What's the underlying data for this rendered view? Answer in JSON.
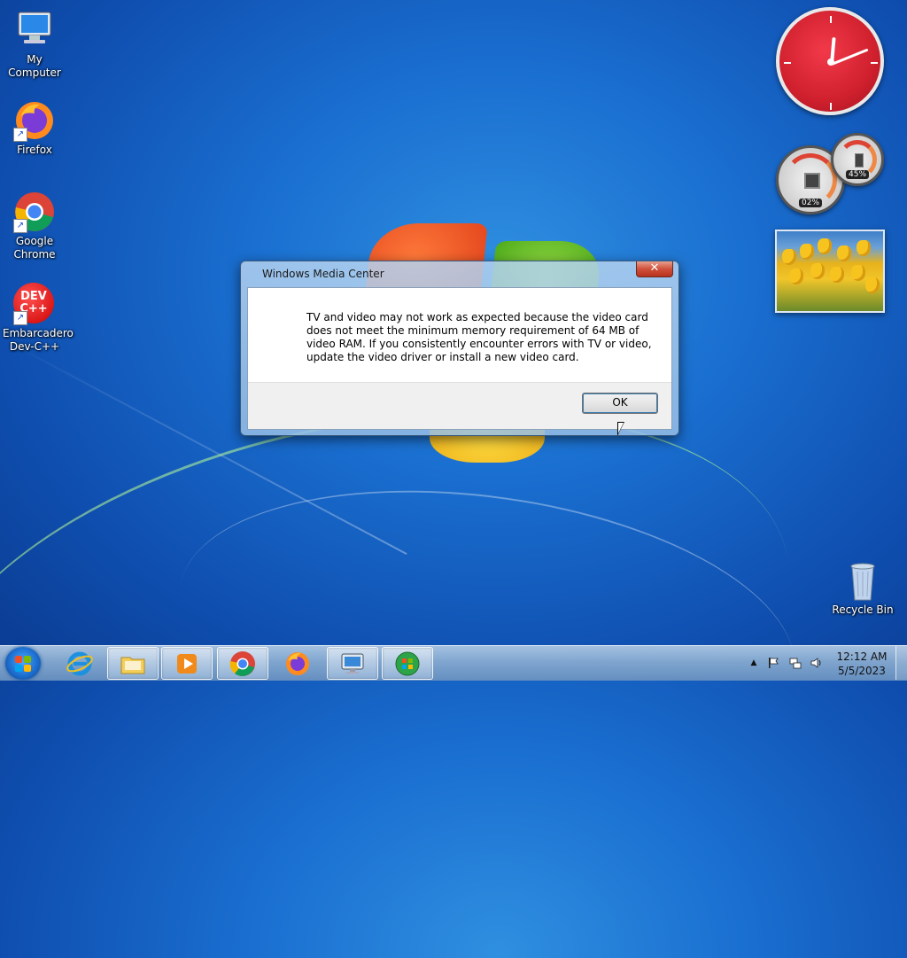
{
  "desktop": {
    "icons": [
      {
        "label": "My Computer",
        "icon": "computer-icon"
      },
      {
        "label": "Firefox",
        "icon": "firefox-icon"
      },
      {
        "label": "Google Chrome",
        "icon": "chrome-icon"
      },
      {
        "label": "Embarcadero Dev-C++",
        "icon": "devcpp-icon",
        "glyph_text": "DEV C++"
      },
      {
        "label": "Recycle Bin",
        "icon": "recycle-bin-icon"
      }
    ]
  },
  "gadgets": {
    "clock": {
      "time_shown": "12:12"
    },
    "cpu_meter": {
      "cpu": "02%",
      "memory": "45%"
    },
    "slideshow": {
      "subject": "yellow tulips"
    }
  },
  "dialog": {
    "title": "Windows Media Center",
    "close_label": "✕",
    "message": "TV and video may not work as expected because the video card does not meet the minimum memory requirement of 64 MB of video RAM. If you consistently encounter errors with TV or video, update the video driver or install a new video card.",
    "ok_label": "OK"
  },
  "taskbar": {
    "pinned": [
      {
        "name": "internet-explorer",
        "icon": "ie-icon"
      },
      {
        "name": "windows-explorer",
        "icon": "folder-icon"
      },
      {
        "name": "media-player",
        "icon": "media-player-icon"
      },
      {
        "name": "chrome",
        "icon": "chrome-icon"
      },
      {
        "name": "firefox",
        "icon": "firefox-icon"
      },
      {
        "name": "remote-desktop",
        "icon": "remote-desktop-icon"
      },
      {
        "name": "windows-media-center",
        "icon": "media-center-icon"
      }
    ],
    "tray": {
      "expand": "▲",
      "time": "12:12 AM",
      "date": "5/5/2023"
    }
  },
  "colors": {
    "desktop_bg": "#1a6fd0",
    "clock_face": "#d0202e",
    "close_button": "#d0503a"
  }
}
